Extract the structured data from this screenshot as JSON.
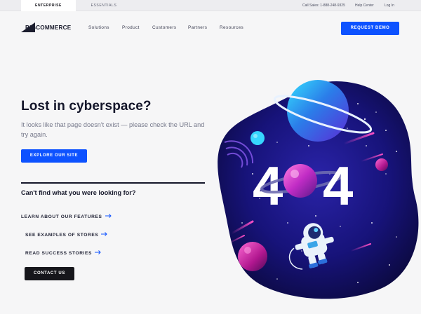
{
  "utility_bar": {
    "tabs": [
      {
        "label": "ENTERPRISE",
        "active": true
      },
      {
        "label": "ESSENTIALS",
        "active": false
      }
    ],
    "sales": "Call Sales: 1-888-248-9325",
    "help": "Help Center",
    "login": "Log In"
  },
  "header": {
    "logo_text": "BIGCOMMERCE",
    "logo_prefix": "BIG",
    "nav": [
      "Solutions",
      "Product",
      "Customers",
      "Partners",
      "Resources"
    ],
    "demo_label": "REQUEST DEMO"
  },
  "hero": {
    "title": "Lost in cyberspace?",
    "subtitle": "It looks like that page doesn't exist — please check the URL and try again.",
    "explore_label": "EXPLORE OUR SITE"
  },
  "help": {
    "heading": "Can't find what you were looking for?",
    "links": [
      {
        "label": "LEARN ABOUT OUR FEATURES"
      },
      {
        "label": "SEE EXAMPLES OF STORES"
      },
      {
        "label": "READ SUCCESS STORIES"
      }
    ],
    "contact_label": "CONTACT US"
  },
  "illustration": {
    "digit_left": "4",
    "digit_right": "4"
  },
  "colors": {
    "accent": "#0d52ff",
    "text_dark": "#14162a",
    "space_dark": "#0c0b3f"
  }
}
